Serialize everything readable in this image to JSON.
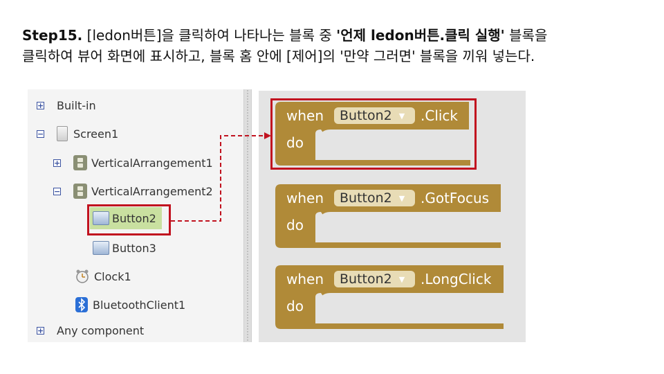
{
  "instruction": {
    "step": "Step15.",
    "line1_part1": " [ledon버튼]을 클릭하여 나타나는 블록 중 ",
    "line1_bold": "'언제 ledon버튼.클릭 실행'",
    "line1_part2": " 블록을",
    "line2": "클릭하여 뷰어 화면에 표시하고, 블록 홈 안에 [제어]의 '만약 그러면' 블록을 끼워 넣는다."
  },
  "tree": {
    "builtin": "Built-in",
    "screen": "Screen1",
    "varr1": "VerticalArrangement1",
    "varr2": "VerticalArrangement2",
    "button2": "Button2",
    "button3": "Button3",
    "clock": "Clock1",
    "bluetooth": "BluetoothClient1",
    "any": "Any component",
    "expand_symbol": "+",
    "collapse_symbol": "−"
  },
  "blocks": [
    {
      "when": "when",
      "component": "Button2",
      "event": ".Click",
      "do": "do"
    },
    {
      "when": "when",
      "component": "Button2",
      "event": ".GotFocus",
      "do": "do"
    },
    {
      "when": "when",
      "component": "Button2",
      "event": ".LongClick",
      "do": "do"
    }
  ],
  "colors": {
    "block": "#b08a38",
    "highlight": "#c1121f",
    "selected": "#c9e0a0"
  },
  "dropdown_arrow": "▼"
}
